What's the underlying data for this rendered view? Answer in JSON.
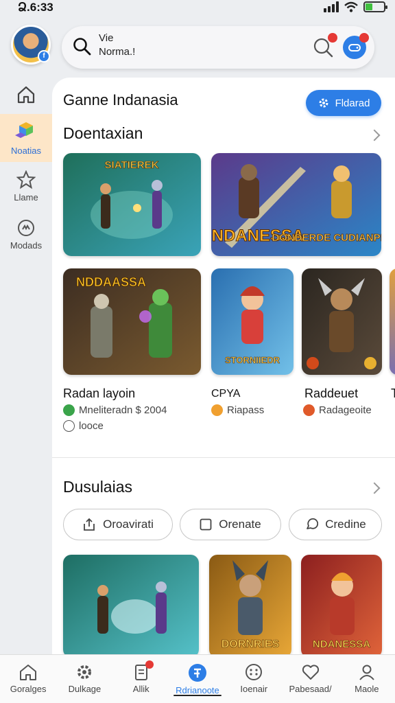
{
  "status": {
    "time": "Ձ.6:33"
  },
  "search": {
    "line1": "Vie",
    "line2": "Norma.!"
  },
  "sidebar": {
    "items": [
      {
        "label": "Noatias",
        "icon": "cubes-icon"
      },
      {
        "label": "Llame",
        "icon": "star-icon"
      },
      {
        "label": "Modads",
        "icon": "mods-icon"
      }
    ]
  },
  "main": {
    "title": "Ganne Indanasia",
    "action_label": "Fldarad",
    "section1": {
      "title": "Doentaxian",
      "banners": [
        {
          "art_text": "SIATIEREK",
          "colors": [
            "#1f6f5a",
            "#3aa3b8"
          ]
        },
        {
          "art_text": "NDANESSA",
          "art_text2": "DONDERDE CUDIANPINS",
          "colors": [
            "#5b3a8a",
            "#2b86c7"
          ]
        }
      ],
      "games": [
        {
          "title": "Radan layoin",
          "meta1": "Mneliteradn $ 2004",
          "meta2": "looce",
          "art_text": "NDDAASSA",
          "colors": [
            "#3c2d22",
            "#7a5a2f"
          ]
        },
        {
          "title": "CPYA",
          "meta1": "Riapass",
          "meta2": "",
          "art_text": "STORNIIEDR",
          "colors": [
            "#2a6fb0",
            "#72c0e8"
          ]
        },
        {
          "title": "Raddeuet",
          "meta1": "Radageoite",
          "meta2": "",
          "art_text": "",
          "colors": [
            "#2b2620",
            "#5a4a3a"
          ]
        },
        {
          "title": "T",
          "meta1": "",
          "meta2": "",
          "art_text": "",
          "colors": [
            "#e0a040",
            "#7a6fb0"
          ]
        }
      ]
    },
    "section2": {
      "title": "Dusulaias",
      "chips": [
        {
          "label": "Oroavirati",
          "icon": "upload-icon"
        },
        {
          "label": "Orenate",
          "icon": "square-icon"
        },
        {
          "label": "Credine",
          "icon": "chat-icon"
        }
      ],
      "games": [
        {
          "art_text": "",
          "colors": [
            "#1e6e63",
            "#55c1c9"
          ]
        },
        {
          "art_text": "DORNRIES",
          "colors": [
            "#8a5a14",
            "#e8a737"
          ]
        },
        {
          "art_text": "NDANESSA",
          "colors": [
            "#8c1f1f",
            "#e0643a"
          ]
        }
      ]
    }
  },
  "bottom_nav": {
    "tabs": [
      {
        "label": "Goralges",
        "icon": "home-icon"
      },
      {
        "label": "Dulkage",
        "icon": "gear-icon"
      },
      {
        "label": "Allik",
        "icon": "doc-icon"
      },
      {
        "label": "Rdrianoote",
        "icon": "compass-icon"
      },
      {
        "label": "Ioenair",
        "icon": "dial-icon"
      },
      {
        "label": "Pabesaad/",
        "icon": "heart-icon"
      },
      {
        "label": "Maole",
        "icon": "user-icon"
      }
    ],
    "active_index": 3
  },
  "colors": {
    "accent": "#2d7ee6",
    "badge": "#e53935",
    "active_side": "#fde6c8"
  }
}
